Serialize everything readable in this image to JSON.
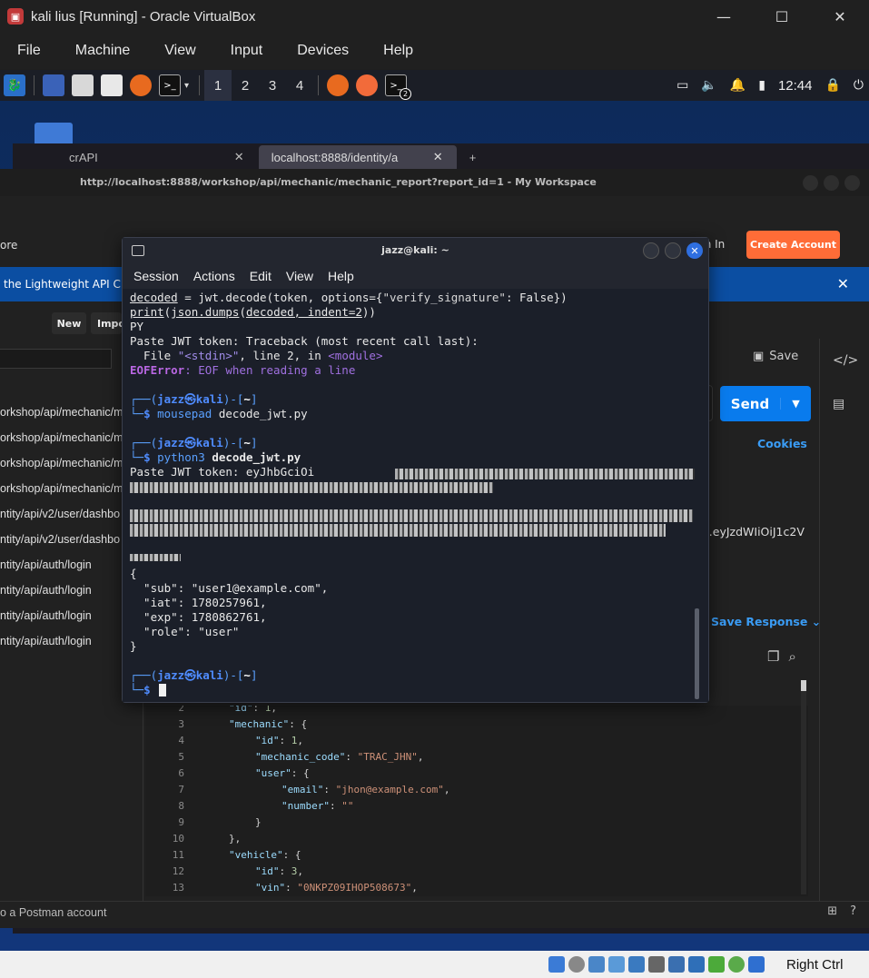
{
  "vbox": {
    "title": "kali lius [Running] - Oracle VirtualBox",
    "menu": [
      "File",
      "Machine",
      "View",
      "Input",
      "Devices",
      "Help"
    ],
    "window_controls": [
      "—",
      "☐",
      "✕"
    ],
    "status": {
      "host_key": "Right Ctrl"
    }
  },
  "kali_panel": {
    "workspaces": [
      "1",
      "2",
      "3",
      "4"
    ],
    "terminal_badge": "2",
    "clock": "12:44"
  },
  "browser": {
    "tabs": [
      {
        "label": "crAPI"
      },
      {
        "label": "localhost:8888/identity/a"
      }
    ],
    "new_tab": "+"
  },
  "postman": {
    "window_title": "http://localhost:8888/workshop/api/mechanic/mechanic_report?report_id=1 - My Workspace",
    "explore": "ore",
    "sign_in": "n In",
    "create_account": "Create Account",
    "banner": "the Lightweight API Cli",
    "new": "New",
    "import": "Impo",
    "history": [
      "orkshop/api/mechanic/me",
      "orkshop/api/mechanic/me",
      "orkshop/api/mechanic/me",
      "orkshop/api/mechanic/me",
      "ntity/api/v2/user/dashbo",
      "ntity/api/v2/user/dashbo",
      "ntity/api/auth/login",
      "ntity/api/auth/login",
      "ntity/api/auth/login",
      "ntity/api/auth/login"
    ],
    "save": "Save",
    "send": "Send",
    "cookies": "Cookies",
    "token_tail": "iIJ9.eyJzdWIiOiJ1c2V",
    "save_response": "Save Response",
    "footer": "o a Postman account",
    "code": [
      {
        "ln": "2",
        "indent": 0,
        "key": "\"id\"",
        "val": "1",
        "type": "n",
        "trail": ","
      },
      {
        "ln": "3",
        "indent": 0,
        "key": "\"mechanic\"",
        "val": "{",
        "type": "p",
        "trail": ""
      },
      {
        "ln": "4",
        "indent": 1,
        "key": "\"id\"",
        "val": "1",
        "type": "n",
        "trail": ","
      },
      {
        "ln": "5",
        "indent": 1,
        "key": "\"mechanic_code\"",
        "val": "\"TRAC_JHN\"",
        "type": "s",
        "trail": ","
      },
      {
        "ln": "6",
        "indent": 1,
        "key": "\"user\"",
        "val": "{",
        "type": "p",
        "trail": ""
      },
      {
        "ln": "7",
        "indent": 2,
        "key": "\"email\"",
        "val": "\"jhon@example.com\"",
        "type": "s",
        "trail": ","
      },
      {
        "ln": "8",
        "indent": 2,
        "key": "\"number\"",
        "val": "\"\"",
        "type": "s",
        "trail": ""
      },
      {
        "ln": "9",
        "indent": 1,
        "key": "",
        "val": "}",
        "type": "p",
        "trail": ""
      },
      {
        "ln": "10",
        "indent": 0,
        "key": "",
        "val": "},",
        "type": "p",
        "trail": ""
      },
      {
        "ln": "11",
        "indent": 0,
        "key": "\"vehicle\"",
        "val": "{",
        "type": "p",
        "trail": ""
      },
      {
        "ln": "12",
        "indent": 1,
        "key": "\"id\"",
        "val": "3",
        "type": "n",
        "trail": ","
      },
      {
        "ln": "13",
        "indent": 1,
        "key": "\"vin\"",
        "val": "\"0NKPZ09IHOP508673\"",
        "type": "s",
        "trail": ","
      }
    ]
  },
  "terminal": {
    "title": "jazz@kali: ~",
    "menu": [
      "Session",
      "Actions",
      "Edit",
      "View",
      "Help"
    ],
    "lines": {
      "l1a": "decoded",
      "l1b": " = jwt.decode(token, options={",
      "l1c": "\"verify_signature\"",
      "l1d": ": False})",
      "l2a": "print",
      "l2b": "(",
      "l2c": "json.dumps",
      "l2d": "(",
      "l2e": "decoded, indent=2",
      "l2f": "))",
      "l3": "PY",
      "l4": "Paste JWT token: Traceback (most recent call last):",
      "l5a": "  File ",
      "l5b": "\"<stdin>\"",
      "l5c": ", line ",
      "l5d": "2",
      "l5e": ", in ",
      "l5f": "<module>",
      "l6a": "EOFError",
      "l6b": ": EOF when reading a line",
      "prompt_user": "jazz㉿kali",
      "prompt_dir": "~",
      "cmd1a": "mousepad",
      "cmd1b": " decode_jwt.py",
      "cmd2a": "python3",
      "cmd2b": " decode_jwt.py",
      "paste": "Paste JWT token: eyJhbGciOi",
      "j_open": "{",
      "j_sub_k": "  \"sub\"",
      "j_sub_v": "\"user1@example.com\"",
      "j_iat_k": "  \"iat\"",
      "j_iat_v": "1780257961",
      "j_exp_k": "  \"exp\"",
      "j_exp_v": "1780862761",
      "j_role_k": "  \"role\"",
      "j_role_v": "\"user\"",
      "j_close": "}"
    }
  }
}
